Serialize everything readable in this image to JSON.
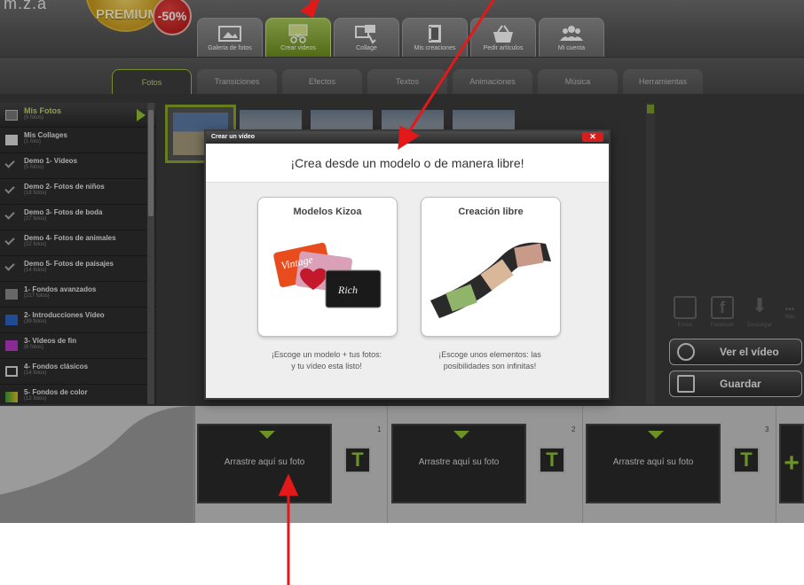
{
  "header": {
    "logo_fragment": "m.z.a",
    "premium_label": "PREMIUM",
    "discount_label": "-50%",
    "main_tabs": [
      {
        "label": "Galeria de fotos",
        "icon": "photo-gallery-icon"
      },
      {
        "label": "Crear videos",
        "icon": "film-scissors-icon"
      },
      {
        "label": "Collage",
        "icon": "collage-icon"
      },
      {
        "label": "Mis creaciones",
        "icon": "film-strip-icon"
      },
      {
        "label": "Pedir artículos",
        "icon": "basket-icon"
      },
      {
        "label": "Mi cuenta",
        "icon": "users-icon"
      }
    ],
    "active_main_tab": "Crear videos"
  },
  "sub_tabs": [
    "Fotos",
    "Transiciones",
    "Efectos",
    "Textos",
    "Animaciones",
    "Música",
    "Herramientas"
  ],
  "active_sub_tab": "Fotos",
  "sidebar": {
    "items": [
      {
        "title": "Mis Fotos",
        "count": "(5 fotos)"
      },
      {
        "title": "Mis Collages",
        "count": "(1 foto)"
      },
      {
        "title": "Demo 1- Vídeos",
        "count": "(5 fotos)"
      },
      {
        "title": "Demo 2- Fotos de niños",
        "count": "(18 fotos)"
      },
      {
        "title": "Demo 3- Fotos de boda",
        "count": "(27 fotos)"
      },
      {
        "title": "Demo 4- Fotos de animales",
        "count": "(22 fotos)"
      },
      {
        "title": "Demo 5- Fotos de paisajes",
        "count": "(14 fotos)"
      },
      {
        "title": "1- Fondos avanzados",
        "count": "(217 fotos)"
      },
      {
        "title": "2- Introducciones Vídeo",
        "count": "(39 fotos)"
      },
      {
        "title": "3- Vídeos de fin",
        "count": "(6 fotos)"
      },
      {
        "title": "4- Fondos clásicos",
        "count": "(14 fotos)"
      },
      {
        "title": "5- Fondos de color",
        "count": "(12 fotos)"
      }
    ]
  },
  "share": {
    "enviar": "Enviar",
    "facebook": "Facebook",
    "descargar": "Descargar",
    "mas": "Más"
  },
  "actions": {
    "ver_video": "Ver el vídeo",
    "guardar": "Guardar"
  },
  "timeline": {
    "slots": [
      {
        "num": "1",
        "label": "Arrastre aquí su foto"
      },
      {
        "num": "2",
        "label": "Arrastre aquí su foto"
      },
      {
        "num": "3",
        "label": "Arrastre aquí su foto"
      }
    ],
    "text_button": "T",
    "add_button": "+"
  },
  "modal": {
    "header": "Crear un vídeo",
    "close": "✕",
    "title": "¡Crea desde un modelo o de manera libre!",
    "option_left": {
      "title": "Modelos Kizoa",
      "desc_line1": "¡Escoge un modelo + tus fotos:",
      "desc_line2": "y tu vídeo esta listo!"
    },
    "option_right": {
      "title": "Creación libre",
      "desc_line1": "¡Escoge unos elementos: las",
      "desc_line2": "posibilidades son infinitas!"
    }
  },
  "colors": {
    "accent_green": "#8fc332",
    "annotation_red": "#e31919",
    "close_red": "#d71e1e"
  }
}
